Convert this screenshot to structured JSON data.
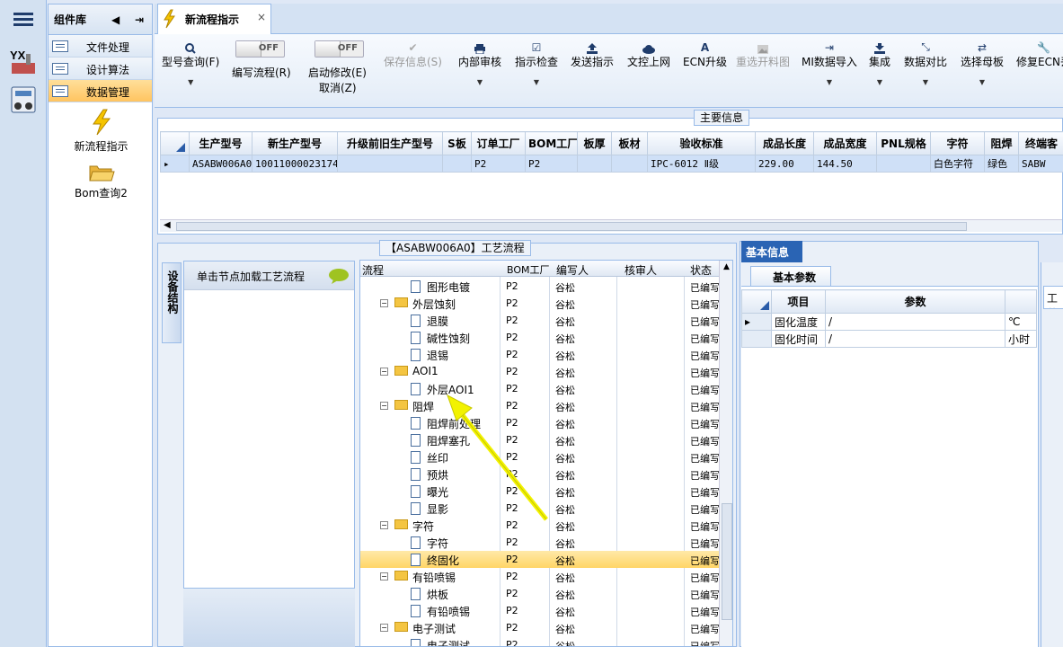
{
  "library": {
    "title": "组件库",
    "items": [
      {
        "label": "文件处理"
      },
      {
        "label": "设计算法"
      },
      {
        "label": "数据管理",
        "active": true
      }
    ],
    "tools": [
      {
        "label": "新流程指示"
      },
      {
        "label": "Bom查询2"
      }
    ]
  },
  "tab": {
    "title": "新流程指示"
  },
  "toolbar": {
    "buttons": [
      {
        "label": "型号查询(F)",
        "icon": "search-icon"
      },
      {
        "label": "编写流程(R)",
        "toggle": "OFF"
      },
      {
        "label": "启动修改(E)",
        "label2": "取消(Z)",
        "toggle": "OFF"
      },
      {
        "label": "保存信息(S)",
        "icon": "check-icon",
        "disabled": true
      },
      {
        "label": "内部审核",
        "icon": "print-icon"
      },
      {
        "label": "指示检查",
        "icon": "checkbox-icon"
      },
      {
        "label": "发送指示",
        "icon": "upload-icon"
      },
      {
        "label": "文控上网",
        "icon": "cloud-upload-icon"
      },
      {
        "label": "ECN升级",
        "icon": "a-icon"
      },
      {
        "label": "重选开料图",
        "icon": "image-icon",
        "disabled": true
      },
      {
        "label": "MI数据导入",
        "icon": "import-icon"
      },
      {
        "label": "集成",
        "icon": "download-icon"
      },
      {
        "label": "数据对比",
        "icon": "compress-icon"
      },
      {
        "label": "选择母板",
        "icon": "shuffle-icon"
      },
      {
        "label": "修复ECN丢",
        "icon": "wrench-icon"
      }
    ]
  },
  "main_info": {
    "legend": "主要信息",
    "columns": [
      "生产型号",
      "新生产型号",
      "升级前旧生产型号",
      "S板",
      "订单工厂",
      "BOM工厂",
      "板厚",
      "板材",
      "验收标准",
      "成品长度",
      "成品宽度",
      "PNL规格",
      "字符",
      "阻焊",
      "终端客"
    ],
    "rows": [
      [
        "ASABW006A0",
        "10011000023174",
        "",
        "",
        "P2",
        "P2",
        "",
        "",
        "IPC-6012 Ⅱ级",
        "229.00",
        "144.50",
        "",
        "白色字符",
        "绿色",
        "SABW"
      ]
    ]
  },
  "process": {
    "legend": "【ASABW006A0】工艺流程",
    "side_tab": "设备结构",
    "hint": "单击节点加载工艺流程",
    "columns": [
      "流程",
      "BOM工厂",
      "编写人",
      "核审人",
      "状态"
    ],
    "rows": [
      {
        "name": "图形电镀",
        "type": "doc",
        "level": 2,
        "bom": "P2",
        "writer": "谷松",
        "reviewer": "",
        "status": "已编写"
      },
      {
        "name": "外层蚀刻",
        "type": "folder",
        "level": 1,
        "bom": "P2",
        "writer": "谷松",
        "reviewer": "",
        "status": "已编写"
      },
      {
        "name": "退膜",
        "type": "doc",
        "level": 2,
        "bom": "P2",
        "writer": "谷松",
        "reviewer": "",
        "status": "已编写"
      },
      {
        "name": "碱性蚀刻",
        "type": "doc",
        "level": 2,
        "bom": "P2",
        "writer": "谷松",
        "reviewer": "",
        "status": "已编写"
      },
      {
        "name": "退锡",
        "type": "doc",
        "level": 2,
        "bom": "P2",
        "writer": "谷松",
        "reviewer": "",
        "status": "已编写"
      },
      {
        "name": "AOI1",
        "type": "folder",
        "level": 1,
        "bom": "P2",
        "writer": "谷松",
        "reviewer": "",
        "status": "已编写"
      },
      {
        "name": "外层AOI1",
        "type": "doc",
        "level": 2,
        "bom": "P2",
        "writer": "谷松",
        "reviewer": "",
        "status": "已编写"
      },
      {
        "name": "阻焊",
        "type": "folder",
        "level": 1,
        "bom": "P2",
        "writer": "谷松",
        "reviewer": "",
        "status": "已编写"
      },
      {
        "name": "阻焊前处理",
        "type": "doc",
        "level": 2,
        "bom": "P2",
        "writer": "谷松",
        "reviewer": "",
        "status": "已编写"
      },
      {
        "name": "阻焊塞孔",
        "type": "doc",
        "level": 2,
        "bom": "P2",
        "writer": "谷松",
        "reviewer": "",
        "status": "已编写"
      },
      {
        "name": "丝印",
        "type": "doc",
        "level": 2,
        "bom": "P2",
        "writer": "谷松",
        "reviewer": "",
        "status": "已编写"
      },
      {
        "name": "预烘",
        "type": "doc",
        "level": 2,
        "bom": "P2",
        "writer": "谷松",
        "reviewer": "",
        "status": "已编写"
      },
      {
        "name": "曝光",
        "type": "doc",
        "level": 2,
        "bom": "P2",
        "writer": "谷松",
        "reviewer": "",
        "status": "已编写"
      },
      {
        "name": "显影",
        "type": "doc",
        "level": 2,
        "bom": "P2",
        "writer": "谷松",
        "reviewer": "",
        "status": "已编写"
      },
      {
        "name": "字符",
        "type": "folder",
        "level": 1,
        "bom": "P2",
        "writer": "谷松",
        "reviewer": "",
        "status": "已编写"
      },
      {
        "name": "字符",
        "type": "doc",
        "level": 2,
        "bom": "P2",
        "writer": "谷松",
        "reviewer": "",
        "status": "已编写"
      },
      {
        "name": "终固化",
        "type": "doc",
        "level": 2,
        "bom": "P2",
        "writer": "谷松",
        "reviewer": "",
        "status": "已编写",
        "selected": true
      },
      {
        "name": "有铅喷锡",
        "type": "folder",
        "level": 1,
        "bom": "P2",
        "writer": "谷松",
        "reviewer": "",
        "status": "已编写"
      },
      {
        "name": "烘板",
        "type": "doc",
        "level": 2,
        "bom": "P2",
        "writer": "谷松",
        "reviewer": "",
        "status": "已编写"
      },
      {
        "name": "有铅喷锡",
        "type": "doc",
        "level": 2,
        "bom": "P2",
        "writer": "谷松",
        "reviewer": "",
        "status": "已编写"
      },
      {
        "name": "电子测试",
        "type": "folder",
        "level": 1,
        "bom": "P2",
        "writer": "谷松",
        "reviewer": "",
        "status": "已编写"
      },
      {
        "name": "电子测试",
        "type": "doc",
        "level": 2,
        "bom": "P2",
        "writer": "谷松",
        "reviewer": "",
        "status": "已编写"
      }
    ]
  },
  "basic": {
    "tab": "基本信息",
    "subtab": "基本参数",
    "columns": [
      "项目",
      "参数",
      ""
    ],
    "rows": [
      [
        "固化温度",
        "/",
        "℃"
      ],
      [
        "固化时间",
        "/",
        "小时"
      ]
    ]
  },
  "right_edge": {
    "label": "工艺"
  }
}
